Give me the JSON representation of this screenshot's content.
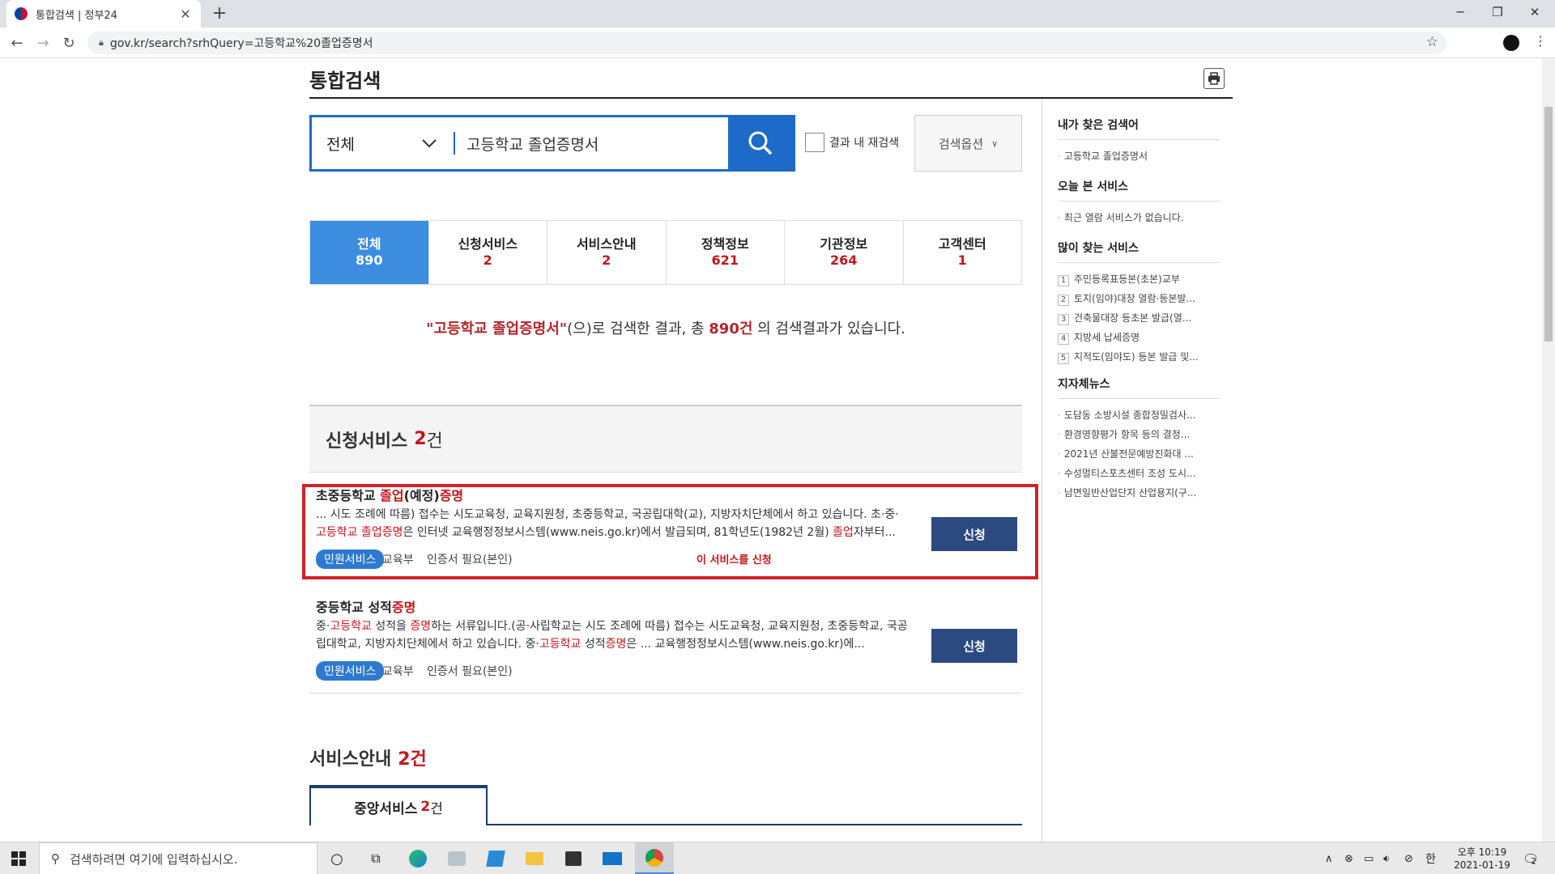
{
  "browser": {
    "tab_title": "통합검색 | 정부24",
    "tab_close": "✕",
    "new_tab": "+",
    "url": "gov.kr/search?srhQuery=고등학교%20졸업증명서",
    "win_min": "─",
    "win_max": "❐",
    "win_close": "✕"
  },
  "page": {
    "title": "통합검색",
    "search": {
      "scope": "전체",
      "query": "고등학교 졸업증명서",
      "recheck_label": "결과 내 재검색",
      "options_label": "검색옵션"
    },
    "tabs": [
      {
        "label": "전체",
        "count": "890"
      },
      {
        "label": "신청서비스",
        "count": "2"
      },
      {
        "label": "서비스안내",
        "count": "2"
      },
      {
        "label": "정책정보",
        "count": "621"
      },
      {
        "label": "기관정보",
        "count": "264"
      },
      {
        "label": "고객센터",
        "count": "1"
      }
    ],
    "summary": {
      "keyword": "\"고등학교 졸업증명서\"",
      "mid": "(으)로 검색한 결과, 총 ",
      "total": "890건",
      "end": " 의 검색결과가 있습니다."
    },
    "section1": {
      "title": "신청서비스",
      "count": "2",
      "unit": "건"
    },
    "results": [
      {
        "title_a": "초중등학교 ",
        "title_b": "졸업",
        "title_c": "(예정)",
        "title_d": "증명",
        "desc_1": "... 시도 조례에 따름) 접수는 시도교육청, 교육지원청, 초중등학교, 국공립대학(교), 지방자치단체에서 하고 있습니다. 초·중·",
        "desc_2": "고등학교 졸업증명",
        "desc_3": "은 인터넷 교육행정정보시스템(www.neis.go.kr)에서 발급되며, 81학년도(1982년 2월) ",
        "desc_4": "졸업",
        "desc_5": "자부터...",
        "badge": "민원서비스",
        "agency": "교육부",
        "auth": "인증서 필요(본인)",
        "apply_link": "이 서비스를 신청",
        "apply_btn": "신청"
      },
      {
        "title_a": "중등학교 성적",
        "title_d": "증명",
        "desc_1": "중·",
        "desc_2": "고등학교",
        "desc_3": " 성적을 ",
        "desc_4": "증명",
        "desc_5": "하는 서류입니다.(공·사립학교는 시도 조례에 따름) 접수는 시도교육청, 교육지원청, 초중등학교, 국공립대학교, 지방자치단체에서 하고 있습니다. 중·",
        "desc_6": "고등학교",
        "desc_7": " 성적",
        "desc_8": "증명",
        "desc_9": "은 ... 교육행정정보시스템(www.neis.go.kr)에...",
        "badge": "민원서비스",
        "agency": "교육부",
        "auth": "인증서 필요(본인)",
        "apply_btn": "신청"
      }
    ],
    "section2": {
      "title": "서비스안내",
      "count": "2건"
    },
    "subtab": {
      "label": "중앙서비스",
      "count": "2",
      "unit": "건"
    }
  },
  "sidebar": {
    "my_search": {
      "title": "내가 찾은 검색어",
      "items": [
        "고등학교 졸업증명서"
      ]
    },
    "today": {
      "title": "오늘 본 서비스",
      "items": [
        "최근 열람 서비스가 없습니다."
      ]
    },
    "popular": {
      "title": "많이 찾는 서비스",
      "items": [
        {
          "rank": "1",
          "label": "주민등록표등본(초본)교부"
        },
        {
          "rank": "2",
          "label": "토지(임야)대장 열람·등본발..."
        },
        {
          "rank": "3",
          "label": "건축물대장 등초본 발급(열..."
        },
        {
          "rank": "4",
          "label": "지방세 납세증명"
        },
        {
          "rank": "5",
          "label": "지적도(임야도) 등본 발급 및..."
        }
      ]
    },
    "news": {
      "title": "지자체뉴스",
      "items": [
        "도담동 소방시설 종합정밀검사...",
        "환경영향평가 항목 등의 결정...",
        "2021년 산불전문예방진화대 ...",
        "수성멀티스포츠센터 조성 도시...",
        "남면일반산업단지 산업용지(구..."
      ]
    }
  },
  "taskbar": {
    "search_placeholder": "검색하려면 여기에 입력하십시오.",
    "ime": "한",
    "time": "오후 10:19",
    "date": "2021-01-19",
    "notif_count": "2"
  }
}
